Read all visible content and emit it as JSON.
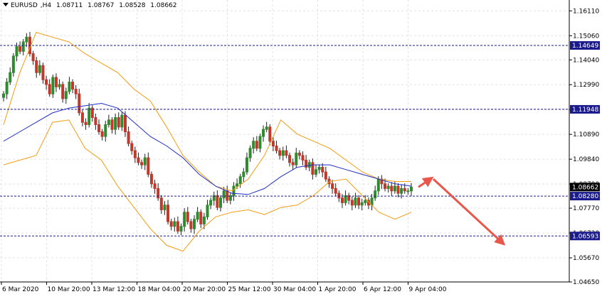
{
  "chart_data": {
    "type": "candlestick",
    "symbol": "EURUSD",
    "timeframe": "H4",
    "ohlc_header": {
      "open": "1.08711",
      "high": "1.08767",
      "low": "1.08528",
      "close": "1.08662"
    },
    "price_range": [
      1.0465,
      1.1657
    ],
    "y_ticks": [
      "1.16110",
      "1.15060",
      "1.14040",
      "1.12990",
      "1.11940",
      "1.10890",
      "1.09840",
      "1.08790",
      "1.07770",
      "1.06720",
      "1.05670",
      "1.04650"
    ],
    "x_ticks": [
      "6 Mar 2020",
      "10 Mar 20:00",
      "13 Mar 12:00",
      "18 Mar 04:00",
      "20 Mar 20:00",
      "25 Mar 12:00",
      "30 Mar 04:00",
      "1 Apr 20:00",
      "6 Apr 12:00",
      "9 Apr 04:00"
    ],
    "levels": [
      {
        "price": 1.14649,
        "label": "1.14649"
      },
      {
        "price": 1.11948,
        "label": "1.11948"
      },
      {
        "price": 1.0828,
        "label": "1.08280"
      },
      {
        "price": 1.06593,
        "label": "1.06593"
      }
    ],
    "current_price": {
      "price": 1.08662,
      "label": "1.08662"
    },
    "closes": [
      1.126,
      1.131,
      1.135,
      1.142,
      1.146,
      1.144,
      1.148,
      1.15,
      1.143,
      1.14,
      1.135,
      1.138,
      1.132,
      1.13,
      1.126,
      1.133,
      1.129,
      1.13,
      1.124,
      1.127,
      1.131,
      1.128,
      1.126,
      1.118,
      1.114,
      1.113,
      1.12,
      1.116,
      1.113,
      1.11,
      1.108,
      1.113,
      1.115,
      1.111,
      1.116,
      1.112,
      1.117,
      1.11,
      1.105,
      1.102,
      1.099,
      1.097,
      1.096,
      1.099,
      1.092,
      1.088,
      1.086,
      1.082,
      1.077,
      1.079,
      1.072,
      1.07,
      1.072,
      1.068,
      1.07,
      1.076,
      1.072,
      1.069,
      1.073,
      1.076,
      1.071,
      1.074,
      1.079,
      1.081,
      1.083,
      1.078,
      1.082,
      1.085,
      1.081,
      1.083,
      1.087,
      1.088,
      1.091,
      1.093,
      1.099,
      1.103,
      1.106,
      1.103,
      1.108,
      1.111,
      1.112,
      1.106,
      1.104,
      1.102,
      1.1,
      1.102,
      1.1,
      1.097,
      1.096,
      1.101,
      1.1,
      1.098,
      1.095,
      1.097,
      1.092,
      1.094,
      1.095,
      1.093,
      1.09,
      1.088,
      1.086,
      1.084,
      1.082,
      1.08,
      1.083,
      1.081,
      1.079,
      1.082,
      1.079,
      1.08,
      1.081,
      1.079,
      1.082,
      1.085,
      1.09,
      1.088,
      1.086,
      1.087,
      1.085,
      1.087,
      1.084,
      1.086,
      1.085,
      1.085,
      1.0866
    ],
    "ma_line": [
      1.106,
      1.11,
      1.114,
      1.118,
      1.12,
      1.121,
      1.122,
      1.12,
      1.114,
      1.108,
      1.104,
      1.099,
      1.092,
      1.087,
      1.084,
      1.0835,
      1.086,
      1.091,
      1.095,
      1.096,
      1.096,
      1.094,
      1.092,
      1.09,
      1.088,
      1.087
    ],
    "bb_upper": [
      1.113,
      1.135,
      1.152,
      1.15,
      1.148,
      1.143,
      1.139,
      1.135,
      1.128,
      1.123,
      1.112,
      1.1,
      1.093,
      1.087,
      1.085,
      1.09,
      1.1,
      1.115,
      1.109,
      1.106,
      1.103,
      1.098,
      1.093,
      1.09,
      1.089,
      1.089
    ],
    "bb_lower": [
      1.096,
      1.098,
      1.1,
      1.114,
      1.115,
      1.103,
      1.098,
      1.087,
      1.078,
      1.069,
      1.062,
      1.0595,
      1.068,
      1.074,
      1.076,
      1.077,
      1.075,
      1.078,
      1.079,
      1.083,
      1.089,
      1.09,
      1.083,
      1.076,
      1.073,
      1.076
    ],
    "forecast_arrows": [
      {
        "from": [
          1.08662,
          1.0866
        ],
        "to": [
          1.09,
          1.09
        ]
      }
    ]
  },
  "colors": {
    "background": "#ffffff",
    "grid": "#e3e3e3",
    "bull_body": "#2e8b2e",
    "bear_body": "#c0392b",
    "ma": "#1f2ec5",
    "bands": "#f39c12",
    "level_line": "#1a1a8c",
    "level_label_bg": "#1a1a8c",
    "current_label_bg": "#000000",
    "arrow": "#e8574a"
  }
}
